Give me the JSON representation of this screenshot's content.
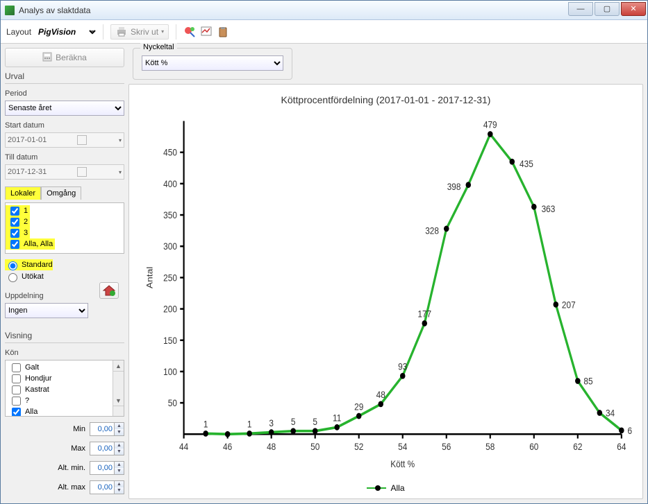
{
  "window": {
    "title": "Analys av slaktdata"
  },
  "toolbar": {
    "layout_label": "Layout",
    "layout_value": "PigVision",
    "print_label": "Skriv ut"
  },
  "left": {
    "compute_label": "Beräkna",
    "urval_label": "Urval",
    "period_label": "Period",
    "period_value": "Senaste året",
    "start_label": "Start datum",
    "start_value": "2017-01-01",
    "till_label": "Till datum",
    "till_value": "2017-12-31",
    "tab_lokaler": "Lokaler",
    "tab_omgang": "Omgång",
    "lokaler_items": [
      "1",
      "2",
      "3",
      "Alla, Alla"
    ],
    "radio_standard": "Standard",
    "radio_utokat": "Utökat",
    "uppdelning_label": "Uppdelning",
    "uppdelning_value": "Ingen",
    "visning_label": "Visning",
    "kon_label": "Kön",
    "kon_items": [
      "Galt",
      "Hondjur",
      "Kastrat",
      "?",
      "Alla"
    ],
    "kon_checked": [
      false,
      false,
      false,
      false,
      true
    ],
    "min_label": "Min",
    "max_label": "Max",
    "altmin_label": "Alt. min.",
    "altmax_label": "Alt. max",
    "spin_value": "0,00"
  },
  "right": {
    "nyckeltal_label": "Nyckeltal",
    "nyckeltal_value": "Kött %",
    "chart_title": "Köttprocentfördelning (2017-01-01 - 2017-12-31)",
    "y_axis_label": "Antal",
    "x_axis_label": "Kött %",
    "legend_label": "Alla"
  },
  "chart_data": {
    "type": "line",
    "title": "Köttprocentfördelning (2017-01-01 - 2017-12-31)",
    "xlabel": "Kött %",
    "ylabel": "Antal",
    "xlim": [
      44,
      64
    ],
    "ylim": [
      0,
      500
    ],
    "x_ticks": [
      44,
      46,
      48,
      50,
      52,
      54,
      56,
      58,
      60,
      62,
      64
    ],
    "y_ticks": [
      50,
      100,
      150,
      200,
      250,
      300,
      350,
      400,
      450
    ],
    "series": [
      {
        "name": "Alla",
        "x": [
          45,
          46,
          47,
          48,
          49,
          50,
          51,
          52,
          53,
          54,
          55,
          56,
          57,
          58,
          59,
          60,
          61,
          62,
          63,
          64
        ],
        "values": [
          1,
          0,
          1,
          3,
          5,
          5,
          11,
          29,
          48,
          93,
          177,
          328,
          398,
          479,
          435,
          363,
          207,
          85,
          34,
          6
        ],
        "labels": [
          "1",
          "",
          "1",
          "3",
          "5",
          "5",
          "11",
          "29",
          "48",
          "93",
          "177",
          "328",
          "398",
          "479",
          "435",
          "363",
          "207",
          "85",
          "34",
          "6"
        ]
      }
    ]
  }
}
